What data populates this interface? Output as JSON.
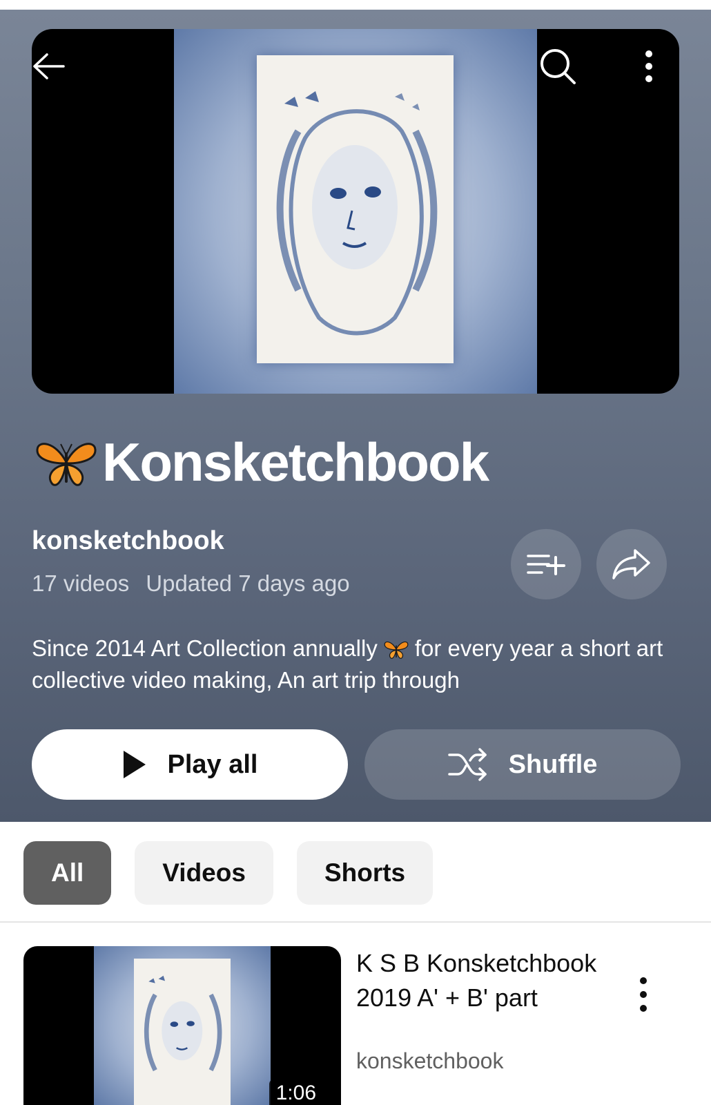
{
  "playlist": {
    "title": "Konsketchbook",
    "channel": "konsketchbook",
    "video_count": "17 videos",
    "updated": "Updated 7 days ago",
    "description_part1": "Since 2014 Art Collection annually",
    "description_part2": "for every year a short art collective video making, An art trip through"
  },
  "actions": {
    "play_all": "Play all",
    "shuffle": "Shuffle"
  },
  "filters": [
    "All",
    "Videos",
    "Shorts"
  ],
  "active_filter": "All",
  "videos": [
    {
      "title": "K S B Konsketchbook 2019 A' + B' part",
      "channel": "konsketchbook",
      "duration": "1:06"
    }
  ],
  "icons": {
    "back": "back-arrow-icon",
    "search": "search-icon",
    "more": "more-vertical-icon",
    "save": "save-to-library-icon",
    "share": "share-icon",
    "play": "play-icon",
    "shuffle": "shuffle-icon",
    "title_emoji": "butterfly-icon"
  },
  "colors": {
    "hero_bg": "#6b778a",
    "chip_active": "#606060",
    "chip_inactive": "#f2f2f2"
  }
}
